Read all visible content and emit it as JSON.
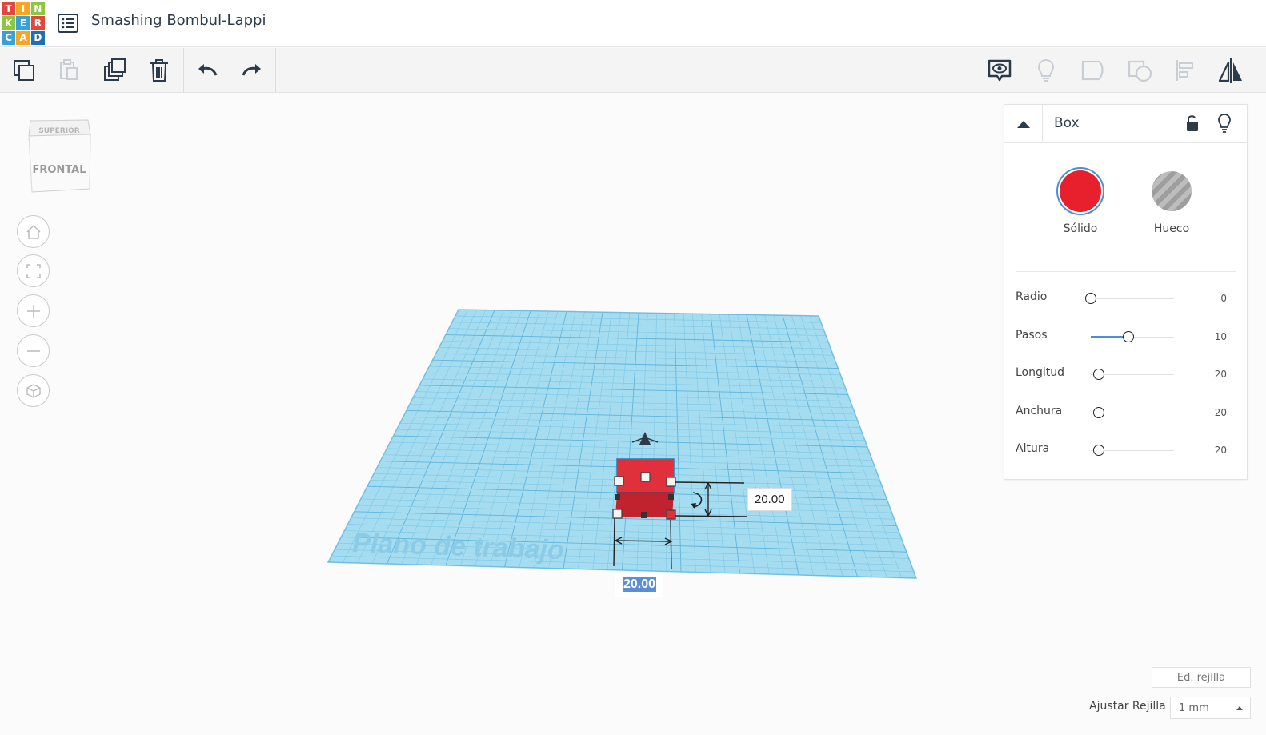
{
  "app": {
    "logo_letters": [
      "T",
      "I",
      "N",
      "K",
      "E",
      "R",
      "C",
      "A",
      "D"
    ],
    "logo_colors": [
      "#e2473f",
      "#f5a623",
      "#8dc63f",
      "#8dc63f",
      "#3aa0d8",
      "#e2473f",
      "#3aa0d8",
      "#f5a623",
      "#1f6fb2"
    ],
    "title": "Smashing Bombul-Lappi"
  },
  "toolbar": {
    "left_tools": [
      "copy-icon",
      "paste-icon",
      "duplicate-icon",
      "delete-icon",
      "undo-icon",
      "redo-icon"
    ],
    "right_tools": [
      "notes-icon",
      "lightbulb-icon",
      "group-icon",
      "ungroup-icon",
      "align-icon",
      "mirror-icon"
    ]
  },
  "viewcube": {
    "top_label": "SUPERIOR",
    "front_label": "FRONTAL"
  },
  "view_controls": [
    "home-icon",
    "fit-icon",
    "zoom-in-icon",
    "zoom-out-icon",
    "perspective-icon"
  ],
  "workplane": {
    "label": "Plano de trabajo",
    "dim_height": "20.00",
    "dim_width": "20.00"
  },
  "inspector": {
    "shape_name": "Box",
    "solid_label": "Sólido",
    "hole_label": "Hueco",
    "solid_color": "#e8202e",
    "props": [
      {
        "label": "Radio",
        "value": "0",
        "level": 0.0
      },
      {
        "label": "Pasos",
        "value": "10",
        "level": 0.45
      },
      {
        "label": "Longitud",
        "value": "20",
        "level": 0.0
      },
      {
        "label": "Anchura",
        "value": "20",
        "level": 0.0
      },
      {
        "label": "Altura",
        "value": "20",
        "level": 0.0
      }
    ]
  },
  "bottom": {
    "grid_edit": "Ed. rejilla",
    "snap_label": "Ajustar Rejilla",
    "snap_value": "1 mm"
  }
}
